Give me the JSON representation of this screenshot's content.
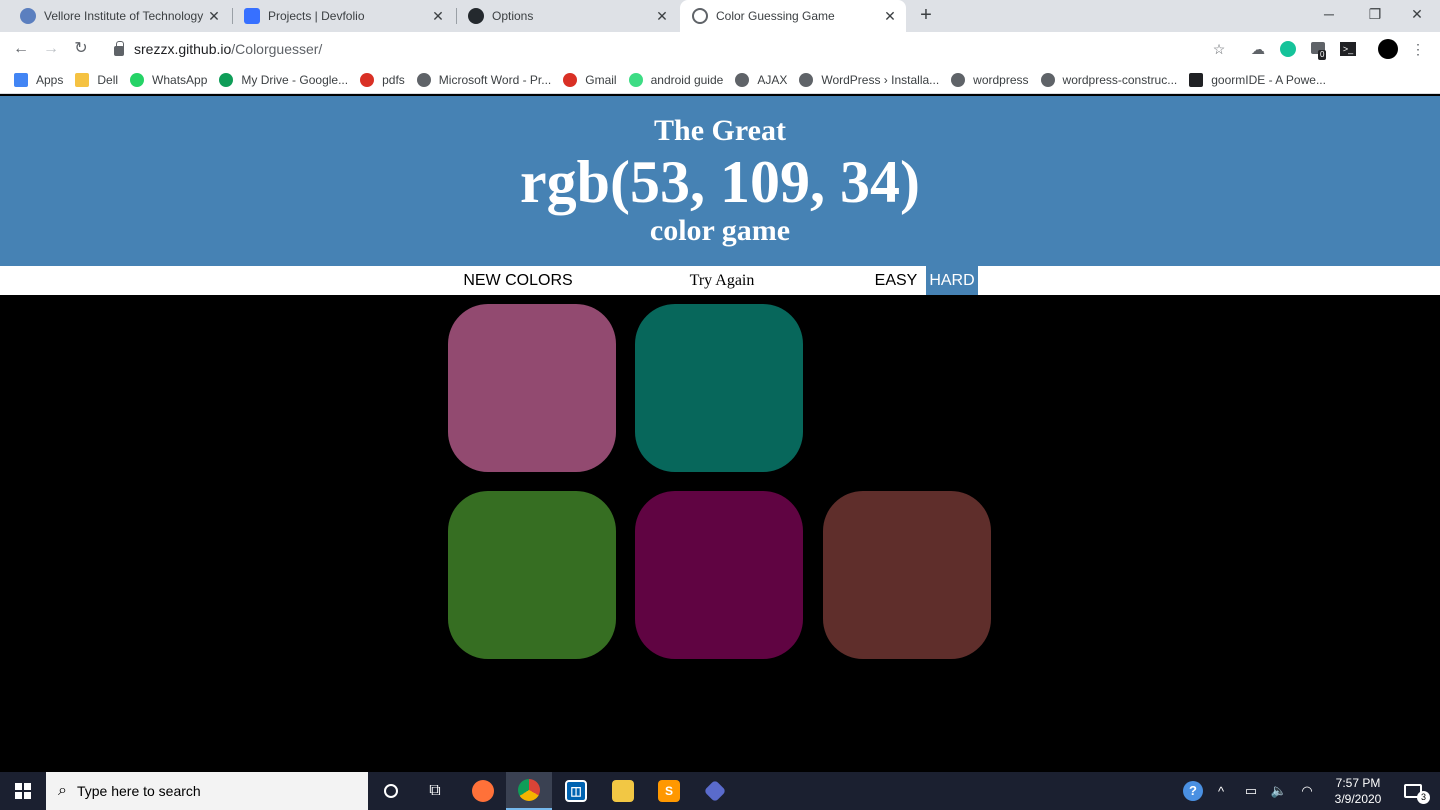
{
  "browser": {
    "tabs": [
      {
        "title": "Vellore Institute of Technology (V",
        "icon": "vit-icon",
        "color": "#5b7fbf"
      },
      {
        "title": "Projects | Devfolio",
        "icon": "devfolio-icon",
        "color": "#3770ff"
      },
      {
        "title": "Options",
        "icon": "github-icon",
        "color": "#24292e"
      },
      {
        "title": "Color Guessing Game",
        "icon": "globe-icon",
        "color": "#5f6368"
      }
    ],
    "url_domain": "srezzx.github.io",
    "url_path": "/Colorguesser/",
    "profile_badge": "0",
    "bookmarks": [
      {
        "label": "Apps",
        "icon": "apps-grid-icon",
        "color": "#4285f4"
      },
      {
        "label": "Dell",
        "icon": "folder-icon",
        "color": "#f5c242"
      },
      {
        "label": "WhatsApp",
        "icon": "whatsapp-icon",
        "color": "#25d366"
      },
      {
        "label": "My Drive - Google...",
        "icon": "google-drive-icon",
        "color": "#0f9d58"
      },
      {
        "label": "pdfs",
        "icon": "pdf-q-icon",
        "color": "#d93025"
      },
      {
        "label": "Microsoft Word - Pr...",
        "icon": "globe-icon",
        "color": "#5f6368"
      },
      {
        "label": "Gmail",
        "icon": "gmail-icon",
        "color": "#d93025"
      },
      {
        "label": "android guide",
        "icon": "android-icon",
        "color": "#3ddc84"
      },
      {
        "label": "AJAX",
        "icon": "globe-icon",
        "color": "#5f6368"
      },
      {
        "label": "WordPress › Installa...",
        "icon": "globe-icon",
        "color": "#5f6368"
      },
      {
        "label": "wordpress",
        "icon": "globe-icon",
        "color": "#5f6368"
      },
      {
        "label": "wordpress-construc...",
        "icon": "globe-icon",
        "color": "#5f6368"
      },
      {
        "label": "goormIDE - A Powe...",
        "icon": "terminal-icon",
        "color": "#202124"
      }
    ]
  },
  "game": {
    "title_top": "The Great",
    "rgb_display": "rgb(53, 109, 34)",
    "title_bottom": "color game",
    "reset_label": "NEW COLORS",
    "message": "Try Again",
    "easy_label": "EASY",
    "hard_label": "HARD",
    "header_color": "#4682b4",
    "squares": [
      {
        "color": "#924a70",
        "visible": true
      },
      {
        "color": "#07675b",
        "visible": true
      },
      {
        "color": "#000000",
        "visible": false
      },
      {
        "color": "#366e22",
        "visible": true
      },
      {
        "color": "#600442",
        "visible": true
      },
      {
        "color": "#5f2e2b",
        "visible": true
      }
    ]
  },
  "taskbar": {
    "search_placeholder": "Type here to search",
    "time": "7:57 PM",
    "date": "3/9/2020",
    "notification_count": "3"
  }
}
